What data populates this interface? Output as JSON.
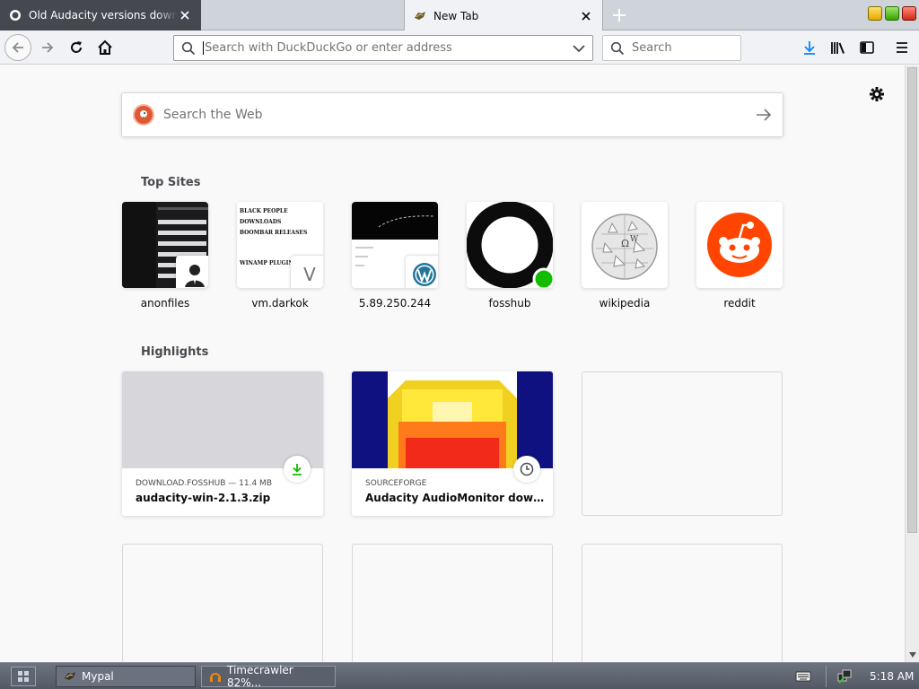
{
  "tabs": [
    {
      "label": "Old Audacity versions downl",
      "active": false
    },
    {
      "label": "New Tab",
      "active": true
    }
  ],
  "urlbar": {
    "placeholder": "Search with DuckDuckGo or enter address"
  },
  "searchbar": {
    "placeholder": "Search"
  },
  "newtab": {
    "web_search_placeholder": "Search the Web",
    "top_sites_title": "Top Sites",
    "top_sites": [
      {
        "label": "anonfiles"
      },
      {
        "label": "vm.darkok",
        "badge_letter": "V"
      },
      {
        "label": "5.89.250.244"
      },
      {
        "label": "fosshub"
      },
      {
        "label": "wikipedia"
      },
      {
        "label": "reddit"
      }
    ],
    "darkok_thumb_lines": [
      "BLACK PEOPLE",
      "DOWNLOADS",
      "BOOMBAR RELEASES",
      "WINAMP PLUGINS"
    ],
    "highlights_title": "Highlights",
    "highlights": [
      {
        "context": "DOWNLOAD.FOSSHUB — 11.4 MB",
        "title": "audacity-win-2.1.3.zip"
      },
      {
        "context": "SOURCEFORGE",
        "title": "Audacity AudioMonitor downloa..."
      }
    ]
  },
  "taskbar": {
    "tasks": [
      {
        "label": "Mypal"
      },
      {
        "label": "Timecrawler 82%..."
      }
    ],
    "clock": "5:18 AM"
  },
  "colors": {
    "reddit": "#ff4500",
    "fosshub_green": "#12bc00",
    "download_blue": "#0a84ff"
  }
}
